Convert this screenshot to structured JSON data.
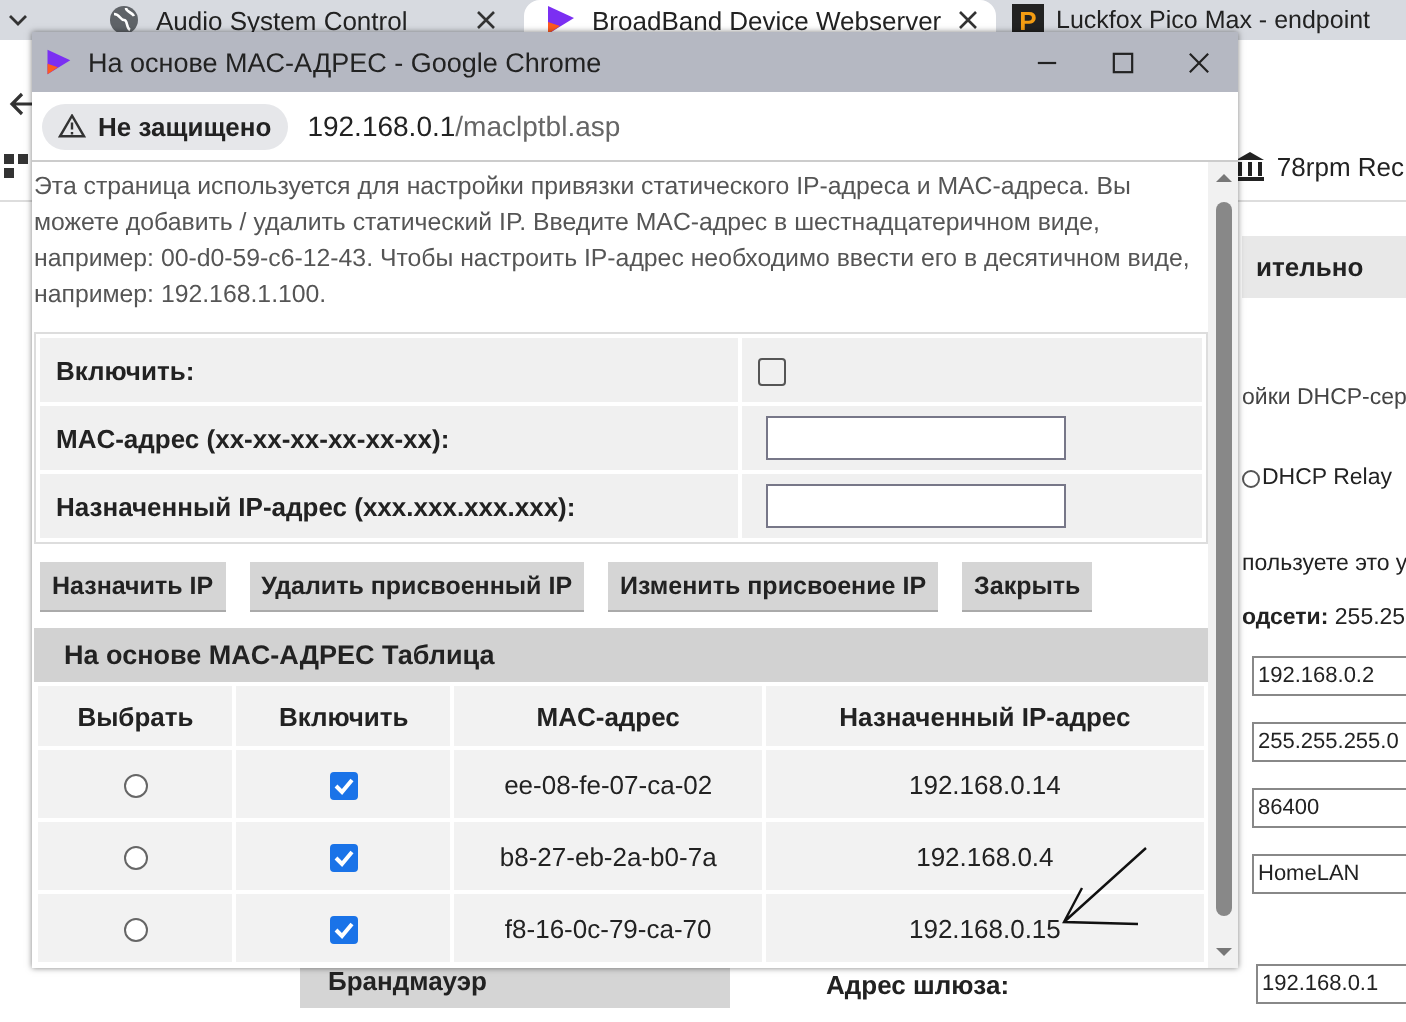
{
  "browser": {
    "tabs": [
      {
        "title": "Audio System Control",
        "selected": false
      },
      {
        "title": "BroadBand Device Webserver",
        "selected": true
      },
      {
        "title": "Luckfox Pico Max - endpoint",
        "selected": false,
        "icon_text": "P"
      }
    ],
    "bookmark": "78rpm Rec"
  },
  "background_page": {
    "nav_tab": "ительно",
    "section_text": "ойки DHCP-сер",
    "radio_label": "DHCP Relay",
    "radio_selected": false,
    "hint": "пользуете это у",
    "subnet_label": "одсети:",
    "subnet_value": "255.25",
    "fields": [
      "192.168.0.2",
      "255.255.255.0",
      "86400",
      "HomeLAN"
    ],
    "gateway_label": "Адрес шлюза:",
    "gateway_value": "192.168.0.1",
    "menu_item": "Брандмауэр"
  },
  "popup": {
    "title": "На основе MAC-АДРЕС - Google Chrome",
    "security": "Не защищено",
    "url_host": "192.168.0.1",
    "url_path": "/maclptbl.asp",
    "intro": "Эта страница используется для настройки привязки статического IP-адреса и MAC-адреса. Вы можете добавить / удалить статический IP. Введите MAC-адрес в шестнадцатеричном виде, например: 00-d0-59-c6-12-43. Чтобы настроить IP-адрес необходимо ввести его в десятичном виде, например: 192.168.1.100.",
    "form": {
      "enable_label": "Включить:",
      "enabled": false,
      "mac_label": "MAC-адрес (xx-xx-xx-xx-xx-xx):",
      "ip_label": "Назначенный IP-адрес (xxx.xxx.xxx.xxx):"
    },
    "buttons": [
      "Назначить IP",
      "Удалить присвоенный IP",
      "Изменить присвоение IP",
      "Закрыть"
    ],
    "table": {
      "title": "На основе MAC-АДРЕС Таблица",
      "columns": [
        "Выбрать",
        "Включить",
        "MAC-адрес",
        "Назначенный IP-адрес"
      ],
      "rows": [
        {
          "selected": false,
          "enabled": true,
          "mac": "ee-08-fe-07-ca-02",
          "ip": "192.168.0.14"
        },
        {
          "selected": false,
          "enabled": true,
          "mac": "b8-27-eb-2a-b0-7a",
          "ip": "192.168.0.4"
        },
        {
          "selected": false,
          "enabled": true,
          "mac": "f8-16-0c-79-ca-70",
          "ip": "192.168.0.15"
        }
      ]
    }
  }
}
